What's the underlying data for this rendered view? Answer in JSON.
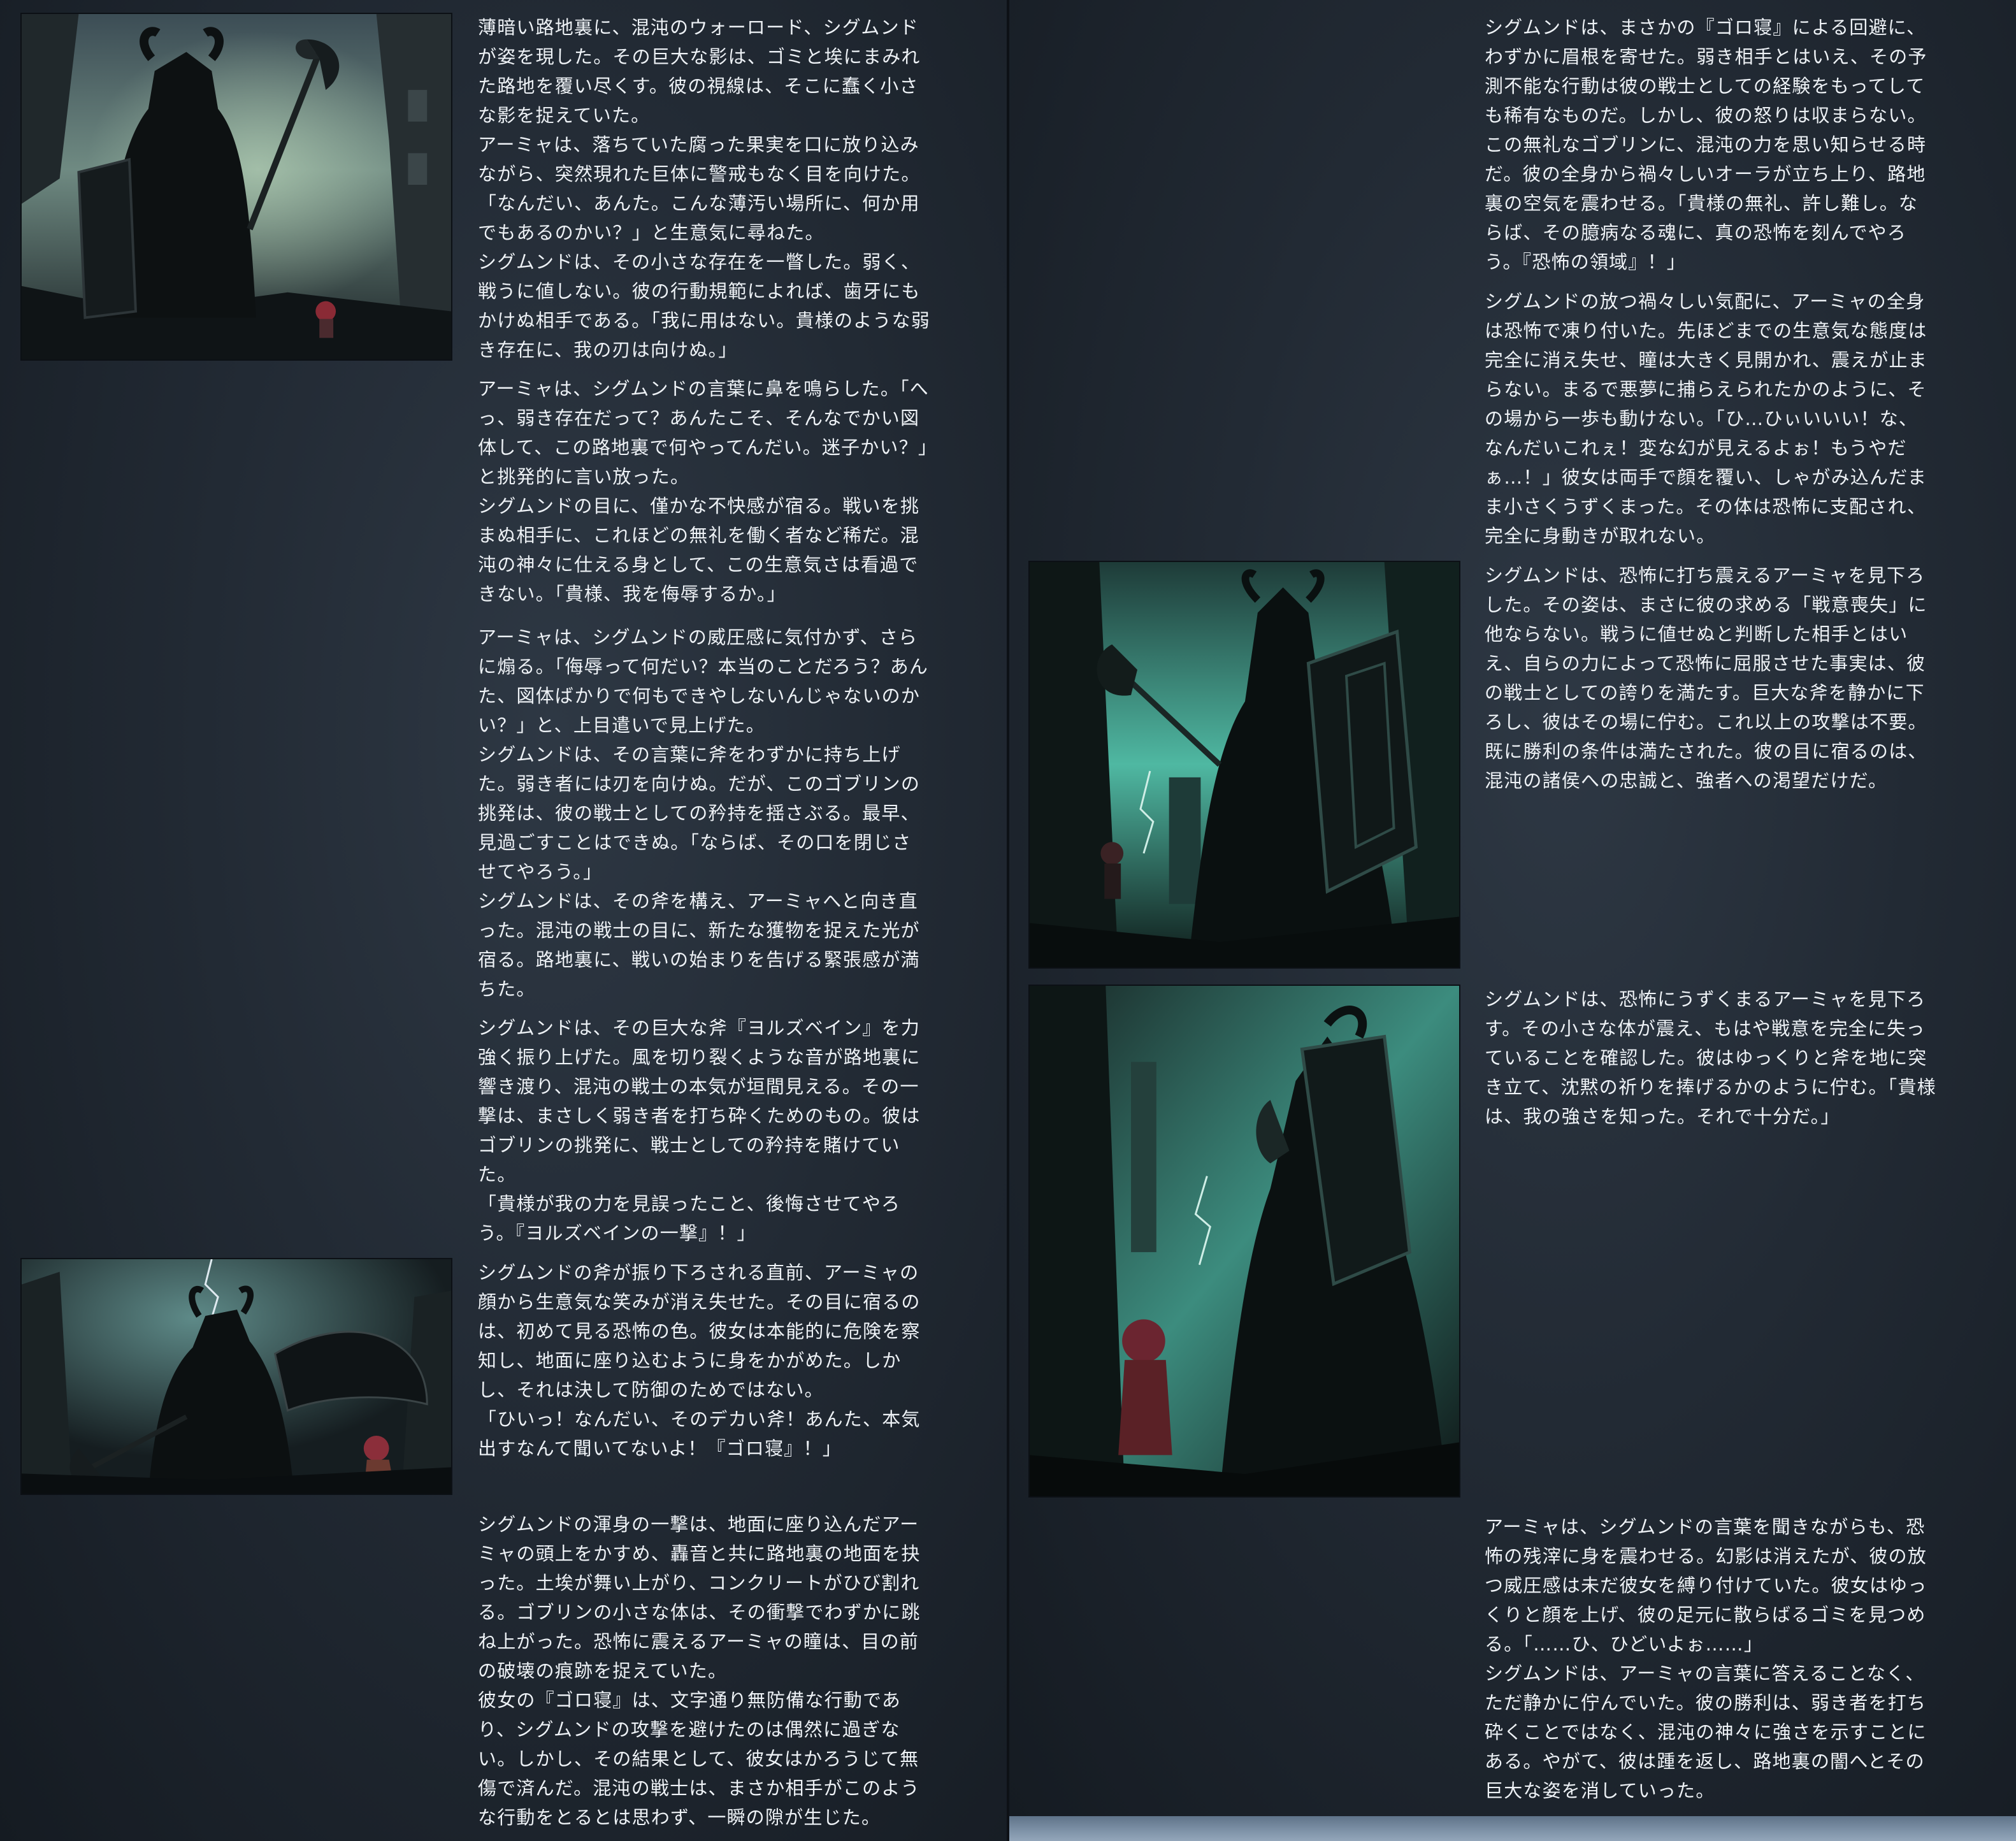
{
  "left": {
    "p1": "薄暗い路地裏に、混沌のウォーロード、シグムンドが姿を現した。その巨大な影は、ゴミと埃にまみれた路地を覆い尽くす。彼の視線は、そこに蠢く小さな影を捉えていた。\nアーミャは、落ちていた腐った果実を口に放り込みながら、突然現れた巨体に警戒もなく目を向けた。「なんだい、あんた。こんな薄汚い場所に、何か用でもあるのかい？」と生意気に尋ねた。\nシグムンドは、その小さな存在を一瞥した。弱く、戦うに値しない。彼の行動規範によれば、歯牙にもかけぬ相手である。「我に用はない。貴様のような弱き存在に、我の刃は向けぬ。」",
    "p2": "アーミャは、シグムンドの言葉に鼻を鳴らした。「へっ、弱き存在だって？あんたこそ、そんなでかい図体して、この路地裏で何やってんだい。迷子かい？」と挑発的に言い放った。\nシグムンドの目に、僅かな不快感が宿る。戦いを挑まぬ相手に、これほどの無礼を働く者など稀だ。混沌の神々に仕える身として、この生意気さは看過できない。「貴様、我を侮辱するか。」",
    "p3": "アーミャは、シグムンドの威圧感に気付かず、さらに煽る。「侮辱って何だい？本当のことだろう？あんた、図体ばかりで何もできやしないんじゃないのかい？」と、上目遣いで見上げた。\nシグムンドは、その言葉に斧をわずかに持ち上げた。弱き者には刃を向けぬ。だが、このゴブリンの挑発は、彼の戦士としての矜持を揺さぶる。最早、見過ごすことはできぬ。「ならば、その口を閉じさせてやろう。」\nシグムンドは、その斧を構え、アーミャへと向き直った。混沌の戦士の目に、新たな獲物を捉えた光が宿る。路地裏に、戦いの始まりを告げる緊張感が満ちた。",
    "p4": "シグムンドは、その巨大な斧『ヨルズベイン』を力強く振り上げた。風を切り裂くような音が路地裏に響き渡り、混沌の戦士の本気が垣間見える。その一撃は、まさしく弱き者を打ち砕くためのもの。彼はゴブリンの挑発に、戦士としての矜持を賭けていた。\n「貴様が我の力を見誤ったこと、後悔させてやろう。『ヨルズベインの一撃』！」",
    "p5": "シグムンドの斧が振り下ろされる直前、アーミャの顔から生意気な笑みが消え失せた。その目に宿るのは、初めて見る恐怖の色。彼女は本能的に危険を察知し、地面に座り込むように身をかがめた。しかし、それは決して防御のためではない。\n「ひいっ！なんだい、そのデカい斧！あんた、本気出すなんて聞いてないよ！『ゴロ寝』！」",
    "p6": "シグムンドの渾身の一撃は、地面に座り込んだアーミャの頭上をかすめ、轟音と共に路地裏の地面を抉った。土埃が舞い上がり、コンクリートがひび割れる。ゴブリンの小さな体は、その衝撃でわずかに跳ね上がった。恐怖に震えるアーミャの瞳は、目の前の破壊の痕跡を捉えていた。\n彼女の『ゴロ寝』は、文字通り無防備な行動であり、シグムンドの攻撃を避けたのは偶然に過ぎない。しかし、その結果として、彼女はかろうじて無傷で済んだ。混沌の戦士は、まさか相手がこのような行動をとるとは思わず、一瞬の隙が生じた。"
  },
  "right": {
    "p1": "シグムンドは、まさかの『ゴロ寝』による回避に、わずかに眉根を寄せた。弱き相手とはいえ、その予測不能な行動は彼の戦士としての経験をもってしても稀有なものだ。しかし、彼の怒りは収まらない。この無礼なゴブリンに、混沌の力を思い知らせる時だ。彼の全身から禍々しいオーラが立ち上り、路地裏の空気を震わせる。「貴様の無礼、許し難し。ならば、その臆病なる魂に、真の恐怖を刻んでやろう。『恐怖の領域』！」",
    "p2": "シグムンドの放つ禍々しい気配に、アーミャの全身は恐怖で凍り付いた。先ほどまでの生意気な態度は完全に消え失せ、瞳は大きく見開かれ、震えが止まらない。まるで悪夢に捕らえられたかのように、その場から一歩も動けない。「ひ…ひぃいいい！な、なんだいこれぇ！変な幻が見えるよぉ！もうやだぁ…！」彼女は両手で顔を覆い、しゃがみ込んだまま小さくうずくまった。その体は恐怖に支配され、完全に身動きが取れない。",
    "p3": "シグムンドは、恐怖に打ち震えるアーミャを見下ろした。その姿は、まさに彼の求める「戦意喪失」に他ならない。戦うに値せぬと判断した相手とはいえ、自らの力によって恐怖に屈服させた事実は、彼の戦士としての誇りを満たす。巨大な斧を静かに下ろし、彼はその場に佇む。これ以上の攻撃は不要。既に勝利の条件は満たされた。彼の目に宿るのは、混沌の諸侯への忠誠と、強者への渇望だけだ。",
    "p4": "シグムンドは、恐怖にうずくまるアーミャを見下ろす。その小さな体が震え、もはや戦意を完全に失っていることを確認した。彼はゆっくりと斧を地に突き立て、沈黙の祈りを捧げるかのように佇む。「貴様は、我の強さを知った。それで十分だ。」",
    "p5": "アーミャは、シグムンドの言葉を聞きながらも、恐怖の残滓に身を震わせる。幻影は消えたが、彼の放つ威圧感は未だ彼女を縛り付けていた。彼女はゆっくりと顔を上げ、彼の足元に散らばるゴミを見つめる。「……ひ、ひどいよぉ……」\nシグムンドは、アーミャの言葉に答えることなく、ただ静かに佇んでいた。彼の勝利は、弱き者を打ち砕くことではなく、混沌の神々に強さを示すことにある。やがて、彼は踵を返し、路地裏の闇へとその巨大な姿を消していった。"
  },
  "colors": {
    "page_bg": "#222a34",
    "text": "#eef2f6",
    "teal_glow": "#4fb8a2",
    "bottom_strip": "#7f93a8"
  },
  "icons": {
    "illustration_1": "warlord-with-axe-and-goblin-in-ruined-street",
    "illustration_2": "warlord-swinging-giant-axe-at-goblin",
    "illustration_3": "warlord-with-shield-facing-small-goblin-in-teal-alley",
    "illustration_4": "warlord-praying-before-goblin-in-teal-alley"
  }
}
